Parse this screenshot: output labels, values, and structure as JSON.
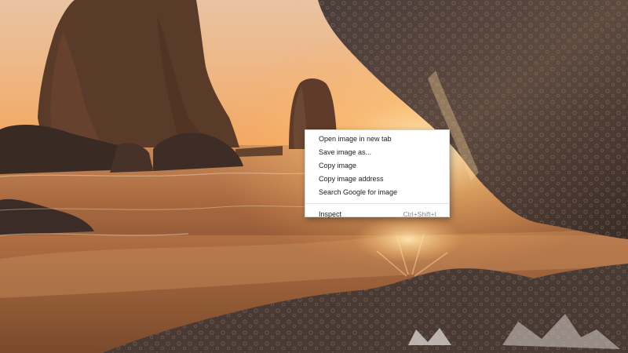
{
  "context_menu": {
    "items": [
      {
        "label": "Open image in new tab"
      },
      {
        "label": "Save image as..."
      },
      {
        "label": "Copy image"
      },
      {
        "label": "Copy image address"
      },
      {
        "label": "Search Google for image"
      }
    ],
    "inspect": {
      "label": "Inspect",
      "shortcut": "Ctrl+Shift+I"
    }
  },
  "colors": {
    "menu_background": "#ffffff",
    "menu_text": "#202124",
    "shortcut_text": "#8a8a8a"
  }
}
